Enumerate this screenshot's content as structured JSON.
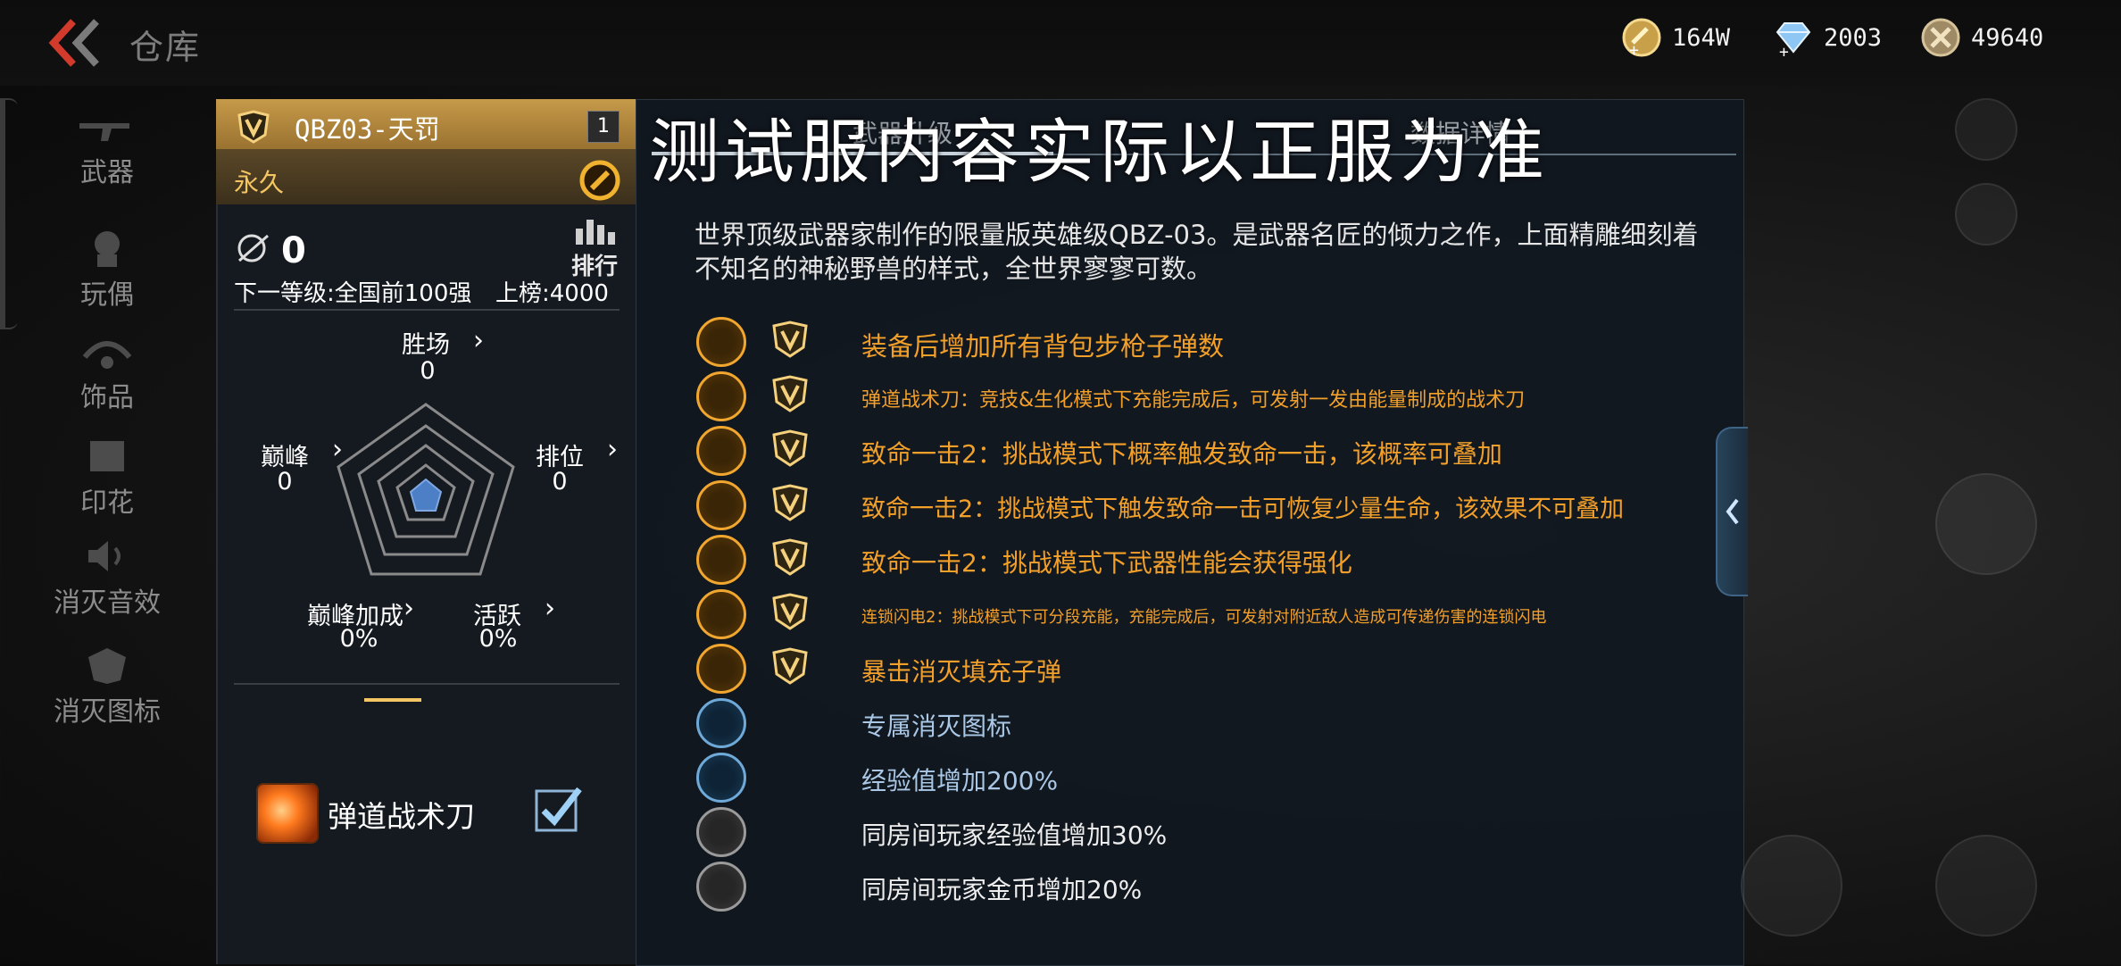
{
  "header": {
    "title": "仓库",
    "currencies": [
      {
        "icon": "gold-coin-icon",
        "value": "164W"
      },
      {
        "icon": "diamond-icon",
        "value": "2003"
      },
      {
        "icon": "honor-coin-icon",
        "value": "49640"
      }
    ]
  },
  "sidebar": {
    "items": [
      {
        "label": "武器",
        "icon": "rifle-icon"
      },
      {
        "label": "玩偶",
        "icon": "doll-icon"
      },
      {
        "label": "饰品",
        "icon": "ornament-icon"
      },
      {
        "label": "印花",
        "icon": "decal-icon"
      },
      {
        "label": "消灭音效",
        "icon": "sound-icon"
      },
      {
        "label": "消灭图标",
        "icon": "emblem-icon"
      }
    ]
  },
  "weapon": {
    "name": "QBZ03-天罚",
    "level": "1",
    "duration": "永久",
    "rank_count": "0",
    "rank_button": "排行",
    "next_level": "下一等级:全国前100强",
    "board": "上榜:4000",
    "stats": {
      "wins": {
        "label": "胜场",
        "value": "0"
      },
      "rank": {
        "label": "排位",
        "value": "0"
      },
      "peak": {
        "label": "巅峰",
        "value": "0"
      },
      "peak_bonus": {
        "label": "巅峰加成",
        "value": "0%"
      },
      "active": {
        "label": "活跃",
        "value": "0%"
      }
    },
    "skill": {
      "label": "弹道战术刀",
      "checked": true
    }
  },
  "tabs": {
    "upgrade": "武器升级",
    "data": "数据详情"
  },
  "watermark": "测试服内容实际以正服为准",
  "description": "世界顶级武器家制作的限量版英雄级QBZ-03。是武器名匠的倾力之作，上面精雕细刻着不知名的神秘野兽的样式，全世界寥寥可数。",
  "effects": [
    {
      "text": "装备后增加所有背包步枪子弹数",
      "color": "orange",
      "icon": "rifle-ammo-icon",
      "vip": true
    },
    {
      "text": "弹道战术刀：竞技&生化模式下充能完成后，可发射一发由能量制成的战术刀",
      "color": "orange",
      "icon": "knife-icon",
      "vip": true
    },
    {
      "text": "致命一击2：挑战模式下概率触发致命一击，该概率可叠加",
      "color": "orange",
      "icon": "fist-icon",
      "vip": true
    },
    {
      "text": "致命一击2：挑战模式下触发致命一击可恢复少量生命，该效果不可叠加",
      "color": "orange",
      "icon": "fist-icon",
      "vip": true
    },
    {
      "text": "致命一击2：挑战模式下武器性能会获得强化",
      "color": "orange",
      "icon": "fist-icon",
      "vip": true
    },
    {
      "text": "连锁闪电2：挑战模式下可分段充能，充能完成后，可发射对附近敌人造成可传递伤害的连锁闪电",
      "color": "orange",
      "icon": "lightning-gun-icon",
      "vip": true
    },
    {
      "text": "暴击消灭填充子弹",
      "color": "orange",
      "icon": "crit-ammo-icon",
      "vip": true
    },
    {
      "text": "专属消灭图标",
      "color": "blue",
      "icon": "kill-emblem-icon",
      "vip": false
    },
    {
      "text": "经验值增加200%",
      "color": "blue",
      "icon": "exp-up-icon",
      "vip": false
    },
    {
      "text": "同房间玩家经验值增加30%",
      "color": "white",
      "icon": "room-exp-icon",
      "vip": false
    },
    {
      "text": "同房间玩家金币增加20%",
      "color": "white",
      "icon": "room-coin-icon",
      "vip": false
    }
  ],
  "colors": {
    "gold": "#f3a02a",
    "header_gold": "#c69a4a",
    "blue": "#aac8e6",
    "panel": "#111820"
  }
}
